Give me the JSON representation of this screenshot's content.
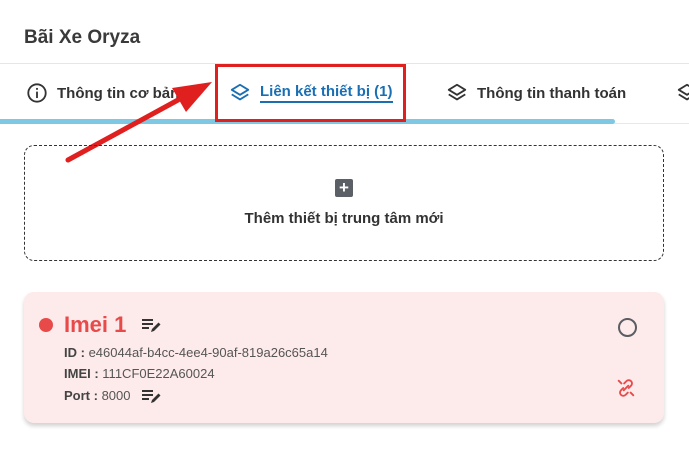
{
  "header": {
    "title": "Bãi Xe Oryza"
  },
  "tabs": [
    {
      "label": "Thông tin cơ bản",
      "icon": "info-circle-icon"
    },
    {
      "label": "Liên kết thiết bị (1)",
      "icon": "layers-icon",
      "active": true
    },
    {
      "label": "Thông tin thanh toán",
      "icon": "layers-icon"
    },
    {
      "label": "",
      "icon": "layers-icon"
    }
  ],
  "add_device": {
    "label": "Thêm thiết bị trung tâm mới",
    "icon": "plus-square-icon"
  },
  "device": {
    "name": "Imei 1",
    "status_color": "#e84a4a",
    "id_label": "ID :",
    "id_value": "e46044af-b4cc-4ee4-90af-819a26c65a14",
    "imei_label": "IMEI :",
    "imei_value": "111CF0E22A60024",
    "port_label": "Port :",
    "port_value": "8000"
  },
  "colors": {
    "accent": "#1a6fb3",
    "highlight": "#e01f1f",
    "card_bg": "#fdeaea",
    "progress": "#7ec8e3"
  }
}
